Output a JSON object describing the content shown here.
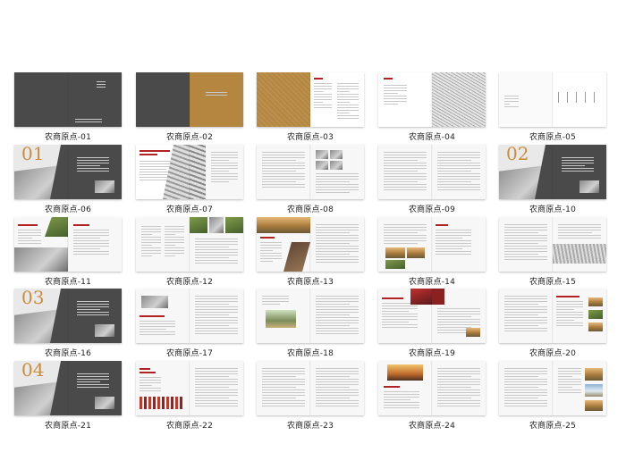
{
  "colors": {
    "dark": "#4a4a4a",
    "gold": "#b5863f",
    "accent": "#b22222",
    "paper": "#f7f7f7"
  },
  "thumbnails": [
    {
      "label": "农商原点-01",
      "layout": "cover-dark"
    },
    {
      "label": "农商原点-02",
      "layout": "dark-gold"
    },
    {
      "label": "农商原点-03",
      "layout": "gold-text"
    },
    {
      "label": "农商原点-04",
      "layout": "text-sketch"
    },
    {
      "label": "农商原点-05",
      "layout": "white-text"
    },
    {
      "label": "农商原点-06",
      "layout": "chapter-01",
      "number": "01"
    },
    {
      "label": "农商原点-07",
      "layout": "title-photo"
    },
    {
      "label": "农商原点-08",
      "layout": "text-photos"
    },
    {
      "label": "农商原点-09",
      "layout": "text-text"
    },
    {
      "label": "农商原点-10",
      "layout": "chapter-02",
      "number": "02"
    },
    {
      "label": "农商原点-11",
      "layout": "green-photo"
    },
    {
      "label": "农商原点-12",
      "layout": "photos-top"
    },
    {
      "label": "农商原点-13",
      "layout": "tilted-photos"
    },
    {
      "label": "农商原点-14",
      "layout": "field-photos"
    },
    {
      "label": "农商原点-15",
      "layout": "text-photo-right"
    },
    {
      "label": "农商原点-16",
      "layout": "chapter-03",
      "number": "03"
    },
    {
      "label": "农商原点-17",
      "layout": "red-title"
    },
    {
      "label": "农商原点-18",
      "layout": "field-left"
    },
    {
      "label": "农商原点-19",
      "layout": "tractor"
    },
    {
      "label": "农商原点-20",
      "layout": "right-photos"
    },
    {
      "label": "农商原点-21",
      "layout": "chapter-04",
      "number": "04"
    },
    {
      "label": "农商原点-22",
      "layout": "red-bars"
    },
    {
      "label": "农商原点-23",
      "layout": "text-text"
    },
    {
      "label": "农商原点-24",
      "layout": "sunset"
    },
    {
      "label": "农商原点-25",
      "layout": "text-field"
    }
  ]
}
